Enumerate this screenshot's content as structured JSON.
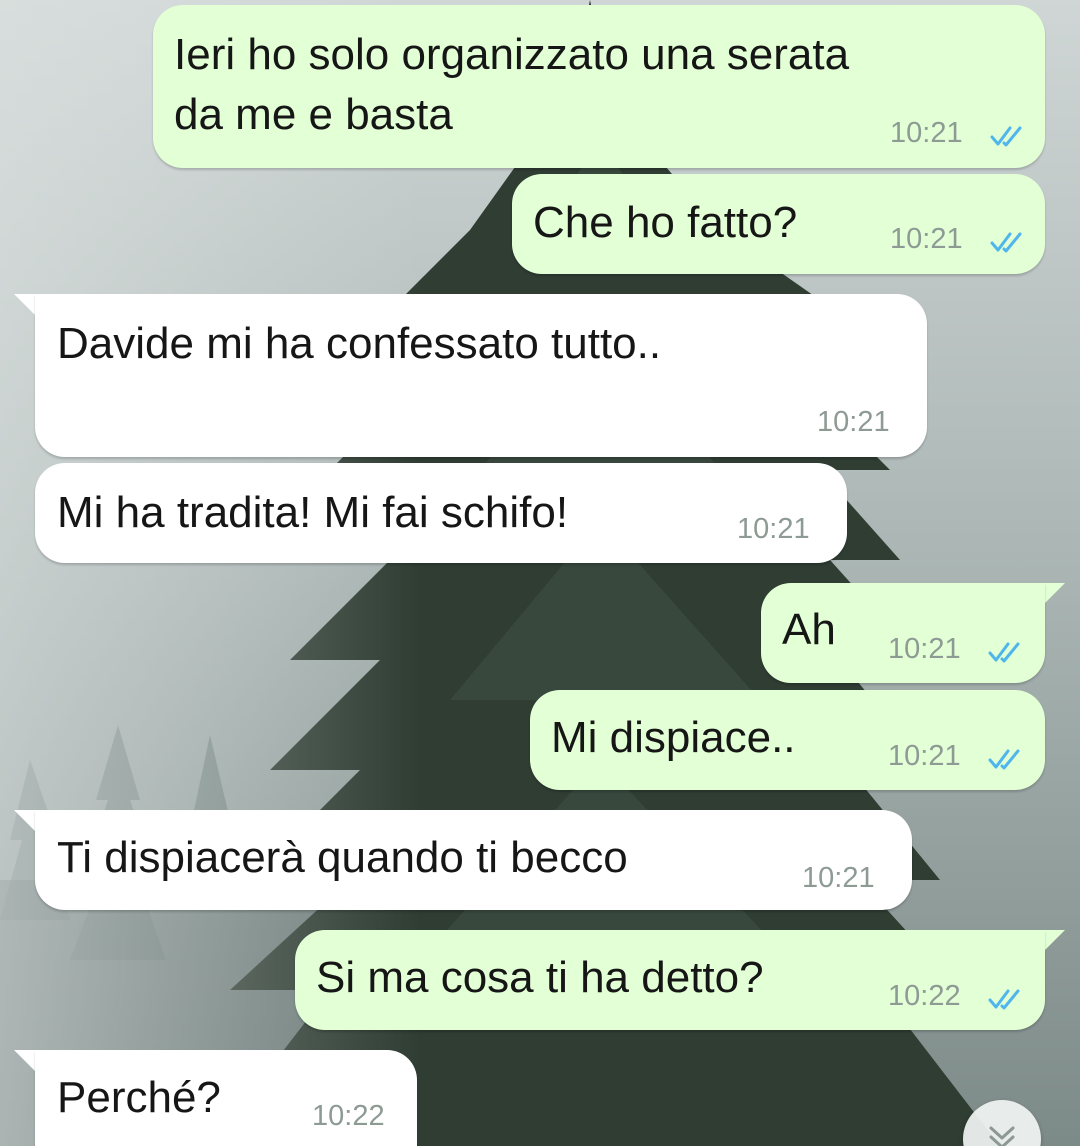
{
  "chat": {
    "messages": [
      {
        "direction": "outgoing",
        "text": "Ieri ho solo organizzato una serata\nda me e basta",
        "time": "10:21",
        "status": "read"
      },
      {
        "direction": "outgoing",
        "text": "Che ho fatto?",
        "time": "10:21",
        "status": "read"
      },
      {
        "direction": "incoming",
        "text": "Davide mi ha confessato tutto..",
        "time": "10:21"
      },
      {
        "direction": "incoming",
        "text": "Mi ha tradita! Mi fai schifo!",
        "time": "10:21"
      },
      {
        "direction": "outgoing",
        "text": "Ah",
        "time": "10:21",
        "status": "read"
      },
      {
        "direction": "outgoing",
        "text": "Mi dispiace..",
        "time": "10:21",
        "status": "read"
      },
      {
        "direction": "incoming",
        "text": "Ti dispiacerà quando ti becco",
        "time": "10:21"
      },
      {
        "direction": "outgoing",
        "text": "Si ma cosa ti ha detto?",
        "time": "10:22",
        "status": "read"
      },
      {
        "direction": "incoming",
        "text": "Perché?",
        "time": "10:22"
      }
    ]
  },
  "icons": {
    "read_receipt": "double-check-icon",
    "scroll_down": "chevron-double-down-icon"
  },
  "colors": {
    "outgoing_bubble": "#e2ffd5",
    "incoming_bubble": "#ffffff",
    "timestamp": "#8e9a94",
    "read_check": "#4fb6ec"
  }
}
